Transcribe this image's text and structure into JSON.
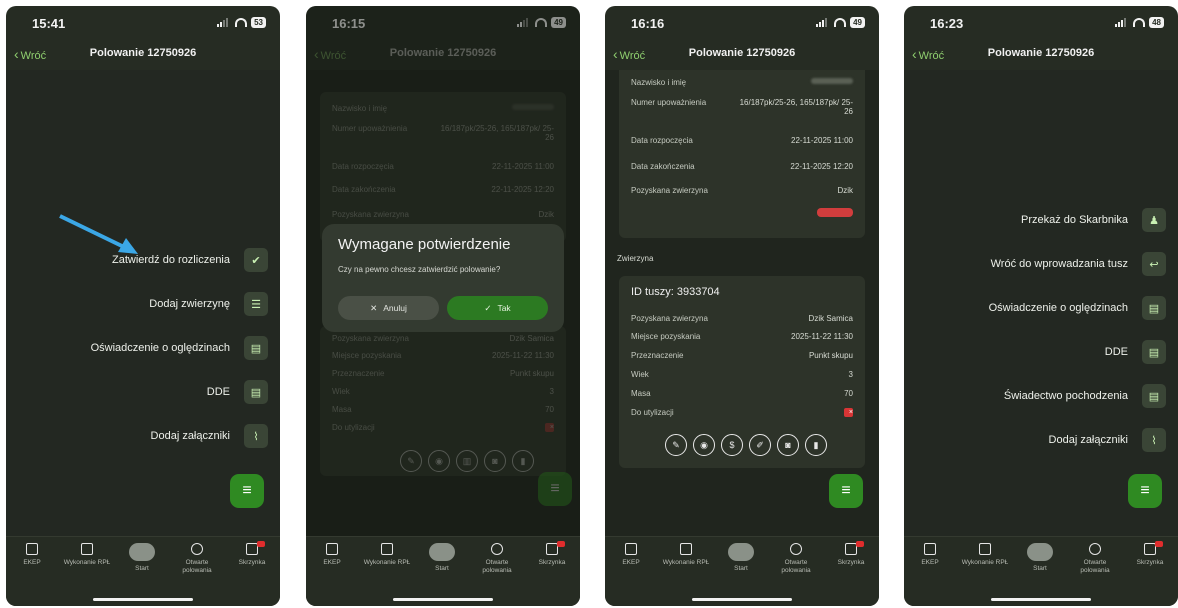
{
  "phones": [
    {
      "time": "15:41",
      "battery": "53",
      "back_label": "Wróć",
      "title": "Polowanie 12750926",
      "menu": [
        {
          "label": "Zatwierdź do rozliczenia",
          "icon": "check-icon"
        },
        {
          "label": "Dodaj zwierzynę",
          "icon": "list-add-icon"
        },
        {
          "label": "Oświadczenie o oględzinach",
          "icon": "document-icon"
        },
        {
          "label": "DDE",
          "icon": "document-icon"
        },
        {
          "label": "Dodaj załączniki",
          "icon": "paperclip-icon"
        }
      ]
    },
    {
      "time": "16:15",
      "battery": "49",
      "back_label": "Wróć",
      "title": "Polowanie 12750926",
      "fields": [
        {
          "k": "Nazwisko i imię",
          "v": ""
        },
        {
          "k": "Numer upoważnienia",
          "v": "16/187pk/25-26, 165/187pk/ 25-26"
        },
        {
          "k": "Data rozpoczęcia",
          "v": "22-11-2025 11:00"
        },
        {
          "k": "Data zakończenia",
          "v": "22-11-2025 12:20"
        },
        {
          "k": "Pozyskana zwierzyna",
          "v": "Dzik"
        }
      ],
      "fields2": [
        {
          "k": "Pozyskana zwierzyna",
          "v": "Dzik Samica"
        },
        {
          "k": "Miejsce pozyskania",
          "v": "2025-11-22 11:30"
        },
        {
          "k": "Przeznaczenie",
          "v": "Punkt skupu"
        },
        {
          "k": "Wiek",
          "v": "3"
        },
        {
          "k": "Masa",
          "v": "70"
        },
        {
          "k": "Do utylizacji",
          "v": "×"
        }
      ],
      "dialog": {
        "title": "Wymagane potwierdzenie",
        "text": "Czy na pewno chcesz zatwierdzić polowanie?",
        "cancel": "Anuluj",
        "ok": "Tak"
      }
    },
    {
      "time": "16:16",
      "battery": "49",
      "back_label": "Wróć",
      "title": "Polowanie 12750926",
      "fields": [
        {
          "k": "Nazwisko i imię",
          "v": ""
        },
        {
          "k": "Numer upoważnienia",
          "v": "16/187pk/25-26, 165/187pk/ 25-26"
        },
        {
          "k": "Data rozpoczęcia",
          "v": "22-11-2025 11:00"
        },
        {
          "k": "Data zakończenia",
          "v": "22-11-2025 12:20"
        },
        {
          "k": "Pozyskana zwierzyna",
          "v": "Dzik"
        }
      ],
      "section": "Zwierzyna",
      "carcass_id": "ID tuszy: 3933704",
      "fields2": [
        {
          "k": "Pozyskana zwierzyna",
          "v": "Dzik Samica"
        },
        {
          "k": "Miejsce pozyskania",
          "v": "2025-11-22 11:30"
        },
        {
          "k": "Przeznaczenie",
          "v": "Punkt skupu"
        },
        {
          "k": "Wiek",
          "v": "3"
        },
        {
          "k": "Masa",
          "v": "70"
        },
        {
          "k": "Do utylizacji",
          "v": "×"
        }
      ]
    },
    {
      "time": "16:23",
      "battery": "48",
      "back_label": "Wróć",
      "title": "Polowanie 12750926",
      "menu": [
        {
          "label": "Przekaż do Skarbnika",
          "icon": "person-icon"
        },
        {
          "label": "Wróć do wprowadzania tusz",
          "icon": "return-icon"
        },
        {
          "label": "Oświadczenie o oględzinach",
          "icon": "document-icon"
        },
        {
          "label": "DDE",
          "icon": "document-icon"
        },
        {
          "label": "Świadectwo pochodzenia",
          "icon": "document-icon"
        },
        {
          "label": "Dodaj załączniki",
          "icon": "paperclip-icon"
        }
      ]
    }
  ],
  "tabs": [
    "EKEP",
    "Wykonanie RPŁ",
    "Start",
    "Otwarte polowania",
    "Skrzynka"
  ],
  "colors": {
    "bg": "#262c23",
    "accent": "#8fcf6f",
    "fab": "#2f8a22",
    "danger": "#d83535"
  }
}
